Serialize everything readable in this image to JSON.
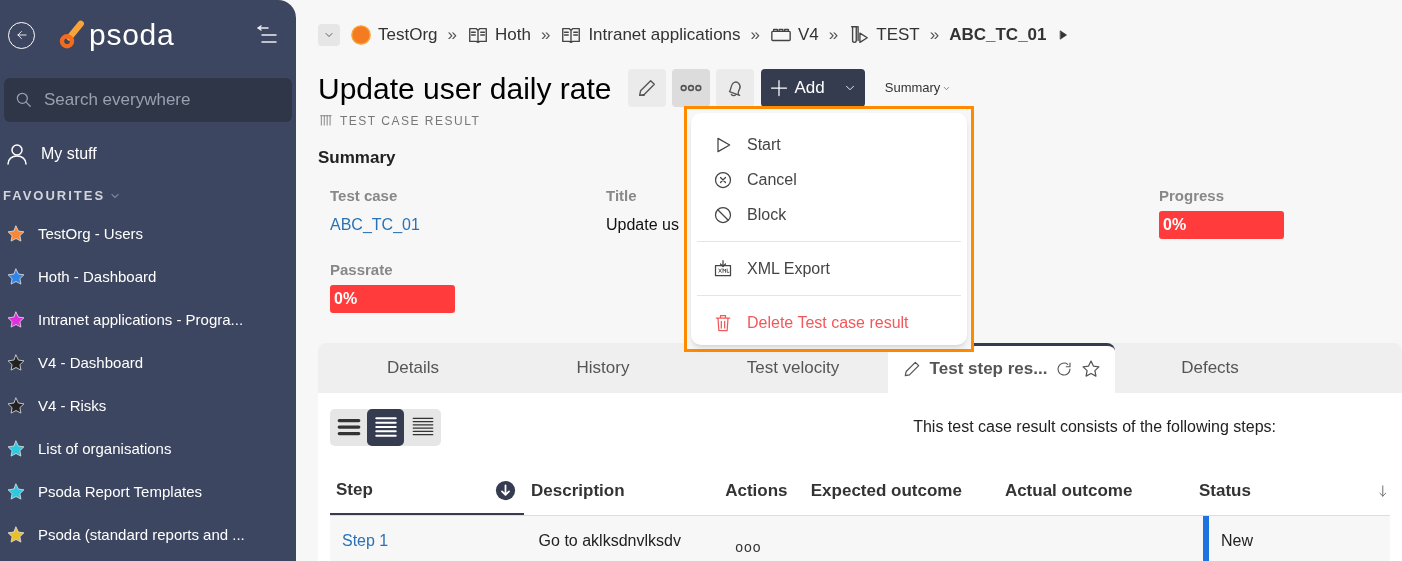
{
  "sidebar": {
    "logo": "psoda",
    "search": {
      "placeholder": "Search everywhere"
    },
    "my_stuff": "My stuff",
    "favourites_heading": "FAVOURITES",
    "favourites": [
      {
        "label": "TestOrg - Users",
        "color": "#f7883a"
      },
      {
        "label": "Hoth - Dashboard",
        "color": "#2f86e8"
      },
      {
        "label": "Intranet applications - Progra...",
        "color": "#e02ee0"
      },
      {
        "label": "V4 - Dashboard",
        "color": "#222222"
      },
      {
        "label": "V4 - Risks",
        "color": "#222222"
      },
      {
        "label": "List of organisations",
        "color": "#2ec8e0"
      },
      {
        "label": "Psoda Report Templates",
        "color": "#2ec8e0"
      },
      {
        "label": "Psoda (standard reports and ...",
        "color": "#e8c02e"
      }
    ]
  },
  "breadcrumbs": [
    {
      "label": "TestOrg",
      "kind": "org",
      "separator": "»"
    },
    {
      "label": "Hoth",
      "kind": "book",
      "separator": "»"
    },
    {
      "label": "Intranet applications",
      "kind": "book",
      "separator": "»"
    },
    {
      "label": "V4",
      "kind": "box",
      "separator": "»"
    },
    {
      "label": "TEST",
      "kind": "tubes",
      "separator": "»"
    },
    {
      "label": "ABC_TC_01",
      "kind": "current"
    }
  ],
  "header": {
    "title": "Update user daily rate",
    "type": "TEST CASE RESULT",
    "add_button": "Add",
    "summary_toggle": "Summary"
  },
  "summary": {
    "heading": "Summary",
    "fields": [
      {
        "label": "Test case",
        "value": "ABC_TC_01",
        "kind": "link"
      },
      {
        "label": "Title",
        "value": "Update us",
        "kind": "text"
      },
      {
        "label": "Progress",
        "value": "0%",
        "kind": "badge"
      },
      {
        "label": "Passrate",
        "value": "0%",
        "kind": "badge"
      }
    ]
  },
  "menu": {
    "items": [
      {
        "label": "Start",
        "kind": "play"
      },
      {
        "label": "Cancel",
        "kind": "cancel"
      },
      {
        "label": "Block",
        "kind": "block",
        "divider_after": true
      },
      {
        "label": "XML Export",
        "kind": "xml",
        "divider_after": true
      },
      {
        "label": "Delete Test case result",
        "kind": "delete"
      }
    ]
  },
  "tabs": [
    {
      "label": "Details",
      "selected": false
    },
    {
      "label": "History",
      "selected": false
    },
    {
      "label": "Test velocity",
      "selected": false
    },
    {
      "label": "Test step res...",
      "selected": true
    },
    {
      "label": "Defects",
      "selected": false
    }
  ],
  "view_modes": [
    {
      "kind": "large",
      "selected": false
    },
    {
      "kind": "medium",
      "selected": true
    },
    {
      "kind": "small",
      "selected": false
    }
  ],
  "intro": "This test case result consists of the following steps:",
  "table": {
    "columns": [
      "Step",
      "Description",
      "Actions",
      "Expected outcome",
      "Actual outcome",
      "Status"
    ],
    "rows": [
      {
        "step": "Step 1",
        "description": "Go to aklksdnvlksdv",
        "actions": "ooo",
        "expected": "",
        "actual": "",
        "status": "New"
      }
    ]
  }
}
